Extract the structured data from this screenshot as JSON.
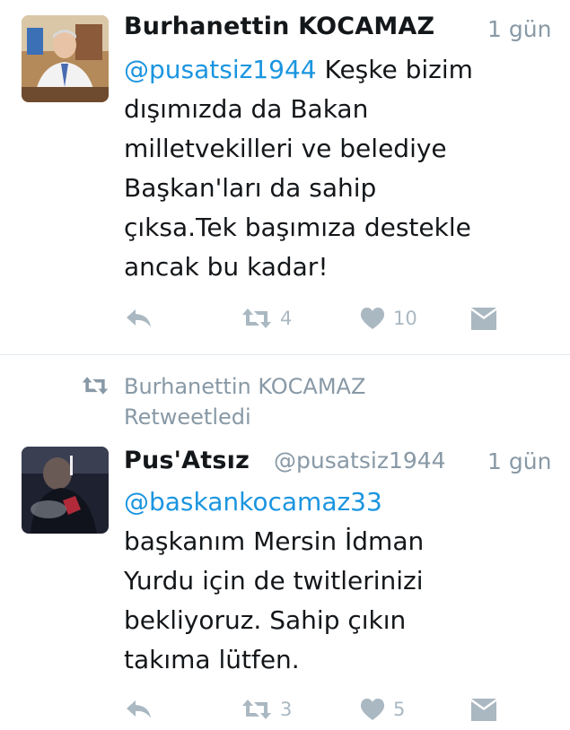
{
  "tweet1": {
    "author": "Burhanettin KOCAMAZ",
    "time": "1 gün",
    "mention": "@pusatsiz1944",
    "text_lines": [
      " Keşke bizim",
      "dışımızda da Bakan",
      "milletvekilleri ve belediye",
      "Başkan'ları da sahip",
      "çıksa.Tek başımıza destekle",
      "ancak bu kadar!"
    ],
    "retweets": "4",
    "likes": "10"
  },
  "retweet_context": {
    "line1": "Burhanettin KOCAMAZ",
    "line2": "Retweetledi"
  },
  "tweet2": {
    "author": "Pus'Atsız",
    "handle": "@pusatsiz1944",
    "time": "1 gün",
    "mention": "@baskankocamaz33",
    "text_lines": [
      "başkanım Mersin İdman",
      "Yurdu için de twitlerinizi",
      "bekliyoruz. Sahip çıkın",
      "takıma lütfen."
    ],
    "retweets": "3",
    "likes": "5"
  },
  "colors": {
    "link": "#1b95e0",
    "muted": "#8899a6",
    "icon": "#aab8c2",
    "divider": "#e1e8ed"
  },
  "icons": [
    "reply-icon",
    "retweet-icon",
    "heart-icon",
    "direct-message-icon"
  ]
}
